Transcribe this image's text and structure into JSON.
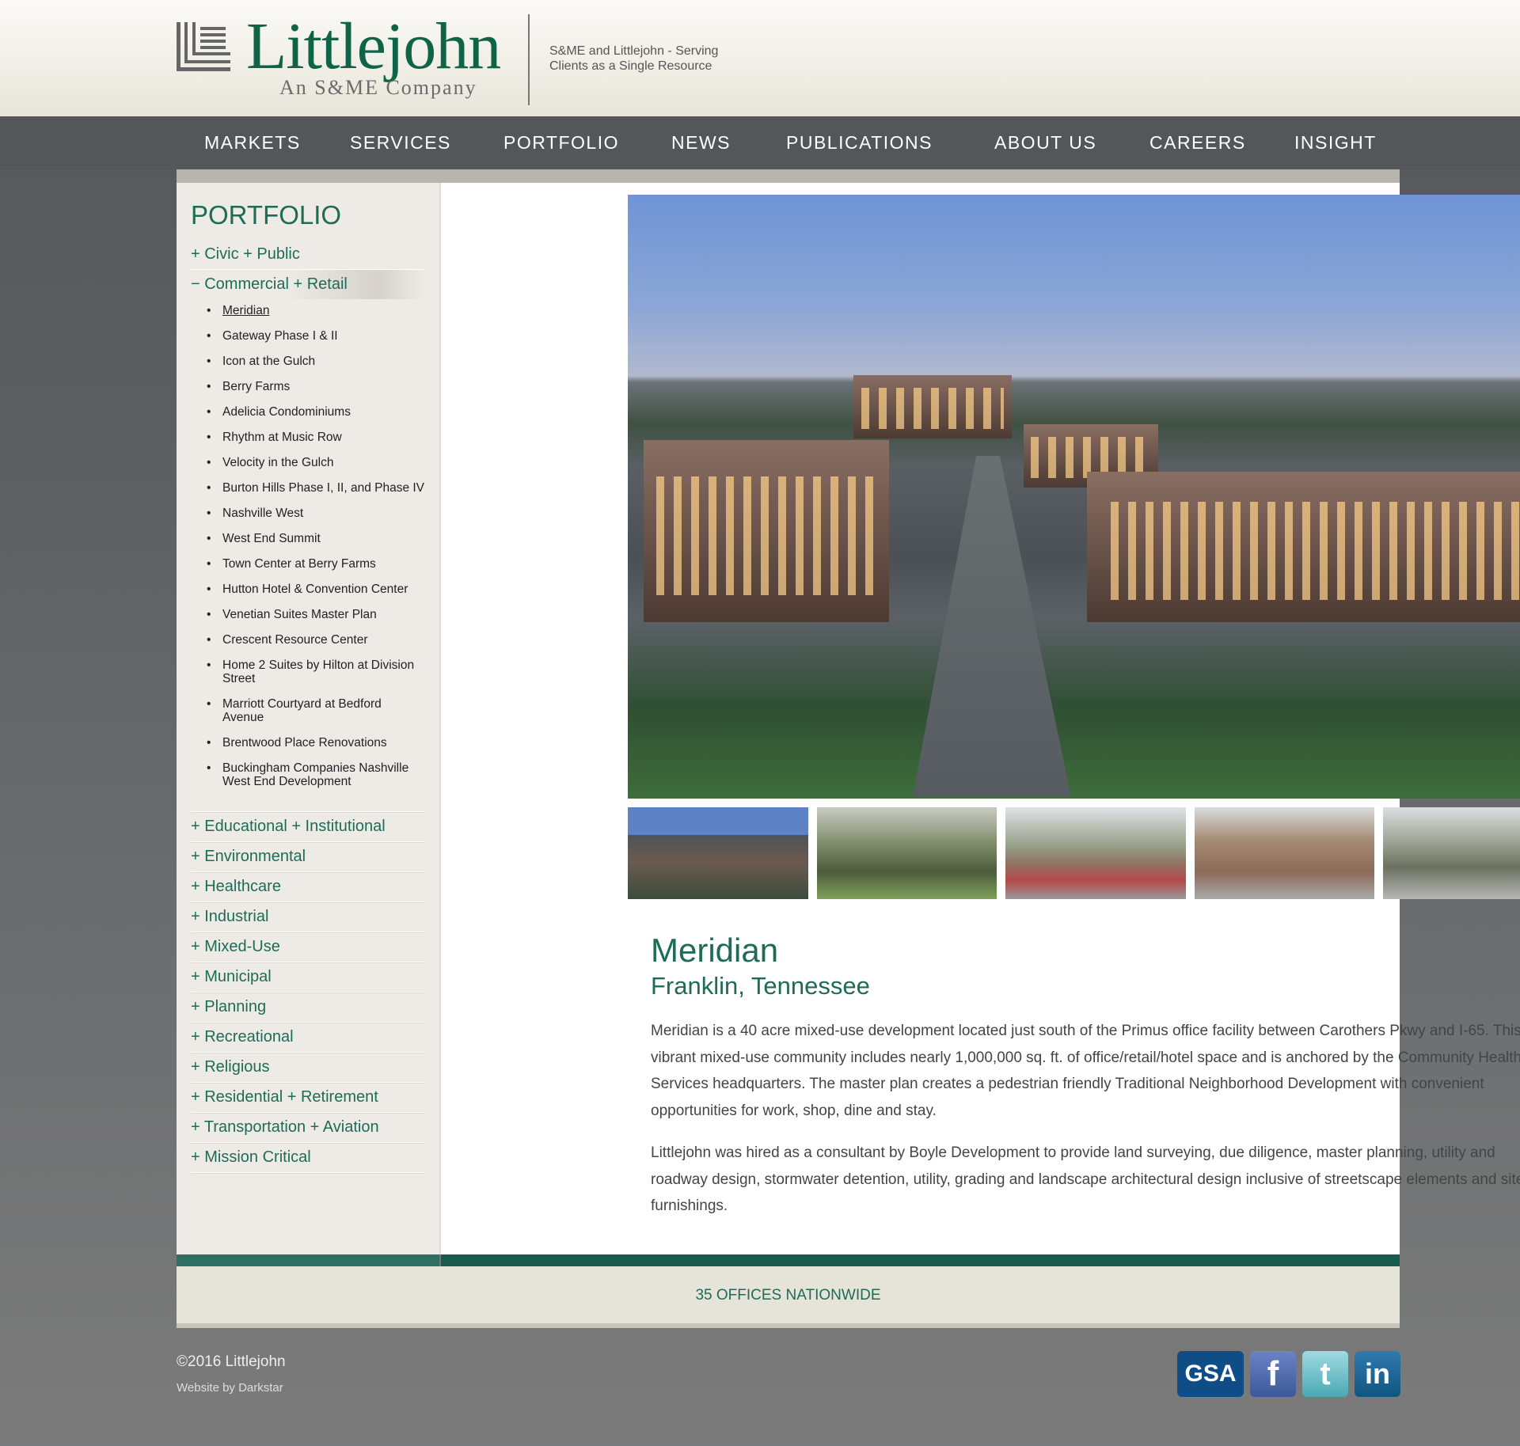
{
  "header": {
    "logo_name": "Littlejohn",
    "logo_sub": "An S&ME Company",
    "tagline": "S&ME and Littlejohn - Serving Clients as a Single Resource"
  },
  "nav": [
    "MARKETS",
    "SERVICES",
    "PORTFOLIO",
    "NEWS",
    "PUBLICATIONS",
    "ABOUT US",
    "CAREERS",
    "INSIGHT"
  ],
  "sidebar": {
    "title": "PORTFOLIO",
    "categories": [
      {
        "label": "+ Civic + Public"
      },
      {
        "label": "− Commercial + Retail",
        "open": true,
        "items": [
          "Meridian",
          "Gateway Phase I & II",
          "Icon at the Gulch",
          "Berry Farms",
          "Adelicia Condominiums",
          "Rhythm at Music Row",
          "Velocity in the Gulch",
          "Burton Hills Phase I, II, and Phase IV",
          "Nashville West",
          "West End Summit",
          "Town Center at Berry Farms",
          "Hutton Hotel & Convention Center",
          "Venetian Suites Master Plan",
          "Crescent Resource Center",
          "Home 2 Suites by Hilton at Division Street",
          "Marriott Courtyard at Bedford Avenue",
          "Brentwood Place Renovations",
          "Buckingham Companies Nashville West End Development"
        ],
        "active_item": "Meridian"
      },
      {
        "label": "+ Educational + Institutional"
      },
      {
        "label": "+ Environmental"
      },
      {
        "label": "+ Healthcare"
      },
      {
        "label": "+ Industrial"
      },
      {
        "label": "+ Mixed-Use"
      },
      {
        "label": "+ Municipal"
      },
      {
        "label": "+ Planning"
      },
      {
        "label": "+ Recreational"
      },
      {
        "label": "+ Religious"
      },
      {
        "label": "+ Residential + Retirement"
      },
      {
        "label": "+ Transportation + Aviation"
      },
      {
        "label": "+ Mission Critical"
      }
    ]
  },
  "project": {
    "title": "Meridian",
    "location": "Franklin, Tennessee",
    "paragraphs": [
      "Meridian is a 40 acre mixed-use development located just south of the Primus office facility between Carothers Pkwy and I-65. This vibrant mixed-use community includes nearly 1,000,000 sq. ft. of office/retail/hotel space and is anchored by the Community Health Services headquarters. The master plan creates a pedestrian friendly Traditional Neighborhood Development with convenient opportunities for work, shop, dine and stay.",
      "Littlejohn was hired as a consultant by Boyle Development to provide land surveying, due diligence, master planning, utility and roadway design, stormwater detention, utility, grading and landscape architectural design inclusive of streetscape elements and site furnishings."
    ],
    "thumbnail_count": 5
  },
  "footer": {
    "offices": "35 OFFICES NATIONWIDE",
    "copyright": "©2016 Littlejohn",
    "credit_prefix": "Website by ",
    "credit_link": "Darkstar",
    "social": [
      {
        "icon": "gsa-icon",
        "label": "GSA"
      },
      {
        "icon": "facebook-icon",
        "label": "f"
      },
      {
        "icon": "twitter-icon",
        "label": "t"
      },
      {
        "icon": "linkedin-icon",
        "label": "in"
      }
    ]
  },
  "colors": {
    "brand_green": "#1e6b58",
    "nav_bg": "#54575a",
    "footer_band": "#e6e3d9"
  }
}
